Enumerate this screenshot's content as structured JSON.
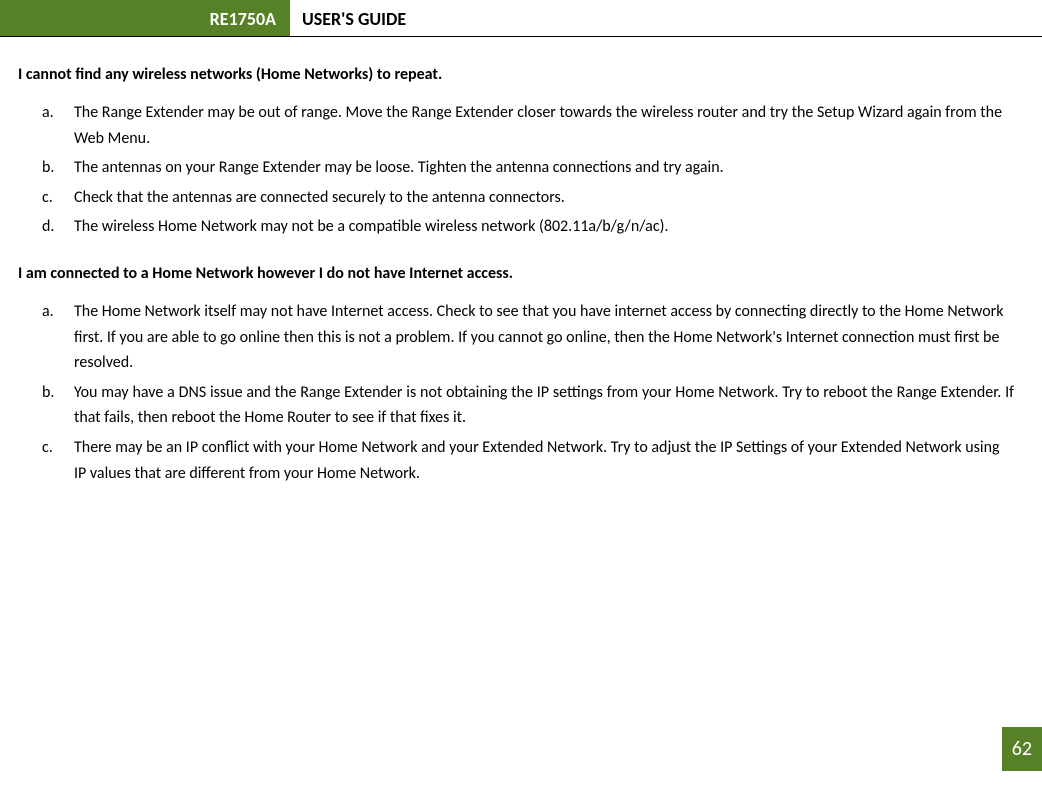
{
  "header": {
    "model": "RE1750A",
    "title": "USER'S GUIDE"
  },
  "sections": [
    {
      "heading": "I cannot find any wireless networks (Home Networks) to repeat.",
      "items": [
        {
          "marker": "a.",
          "text": "The Range Extender may be out of range. Move the Range Extender closer towards the wireless router and try the Setup Wizard again from the Web Menu.",
          "justify": false
        },
        {
          "marker": "b.",
          "text": "The antennas on your Range Extender may be loose. Tighten the antenna connections and try again.",
          "justify": false
        },
        {
          "marker": "c.",
          "text": "Check that the antennas are connected securely to the antenna connectors.",
          "justify": false
        },
        {
          "marker": "d.",
          "text": "The wireless Home Network may not be a compatible wireless network (802.11a/b/g/n/ac).",
          "justify": false
        }
      ]
    },
    {
      "heading": "I am connected to a Home Network however I do not have Internet access.",
      "items": [
        {
          "marker": "a.",
          "text": "The Home Network itself may not have Internet access. Check to see that you have internet access by connecting directly to the Home Network first. If you are able to go online then this is not a problem. If you cannot go online, then the Home Network's Internet connection must first be resolved.",
          "justify": false
        },
        {
          "marker": "b.",
          "text": "You may have a DNS issue and the Range Extender is not obtaining the IP settings from your Home Network. Try to reboot the Range Extender. If that fails, then reboot the Home Router to see if that fixes it.",
          "justify": true
        },
        {
          "marker": "c.",
          "text": "There may be an IP conflict with your Home Network and your Extended Network. Try to adjust the IP Settings of your Extended Network using IP values that are different from your Home Network.",
          "justify": false
        }
      ]
    }
  ],
  "page_number": "62"
}
